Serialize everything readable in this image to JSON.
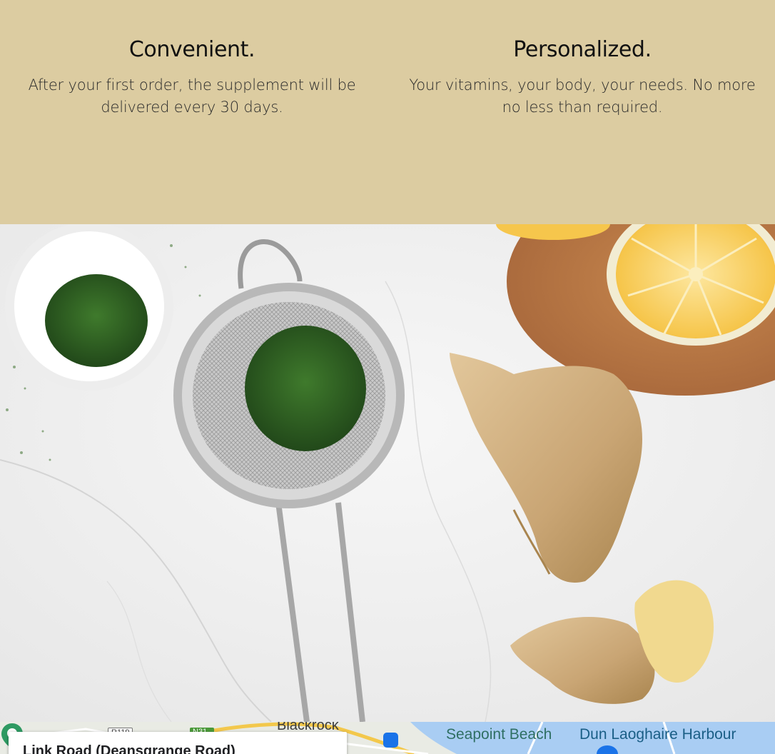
{
  "features": [
    {
      "title": "Convenient.",
      "text": "After your first order, the supplement will be delivered every 30 days."
    },
    {
      "title": "Personalized.",
      "text": "Your vitamins, your body, your needs. No more no less than required."
    }
  ],
  "photo": {
    "subject": "herbs-strainer-ginger-lemon-photo"
  },
  "map": {
    "place_label": "Link Road (Deansgrange Road)",
    "labels": {
      "blackrock": "Blackrock",
      "seapoint": "Seapoint Beach",
      "dun_laoghaire": "Dun Laoghaire Harbour"
    },
    "road_badges": {
      "regional": "R119",
      "national": "N31"
    }
  },
  "colors": {
    "band_background": "#dccca1",
    "map_water": "#a9cdf3",
    "map_land": "#e9ebe4"
  }
}
